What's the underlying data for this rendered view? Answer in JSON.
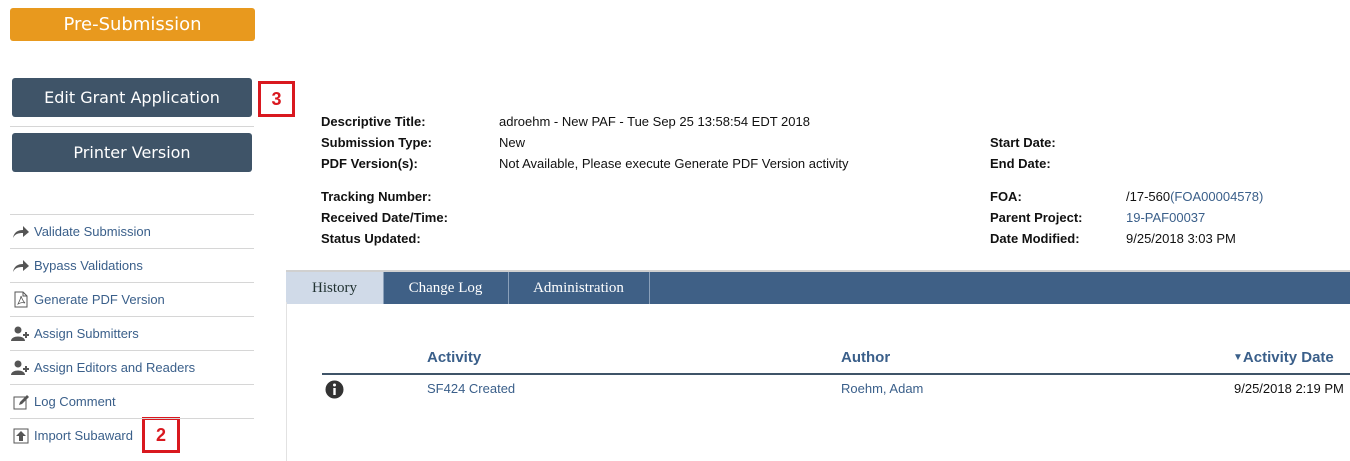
{
  "status": {
    "label": "Pre-Submission",
    "color": "#e8991e"
  },
  "actions": {
    "edit": "Edit Grant Application",
    "print": "Printer Version"
  },
  "callouts": {
    "edit_marker": "3",
    "import_marker": "2"
  },
  "sidebar": {
    "items": [
      {
        "label": "Validate Submission",
        "icon": "share-arrow-icon"
      },
      {
        "label": "Bypass Validations",
        "icon": "share-arrow-icon"
      },
      {
        "label": "Generate PDF Version",
        "icon": "pdf-icon"
      },
      {
        "label": "Assign Submitters",
        "icon": "user-add-icon"
      },
      {
        "label": "Assign Editors and Readers",
        "icon": "user-add-icon"
      },
      {
        "label": "Log Comment",
        "icon": "edit-note-icon"
      },
      {
        "label": "Import Subaward",
        "icon": "upload-icon"
      }
    ]
  },
  "details": {
    "descriptive_title": {
      "label": "Descriptive Title:",
      "value": "adroehm - New PAF - Tue Sep 25 13:58:54 EDT 2018"
    },
    "submission_type": {
      "label": "Submission Type:",
      "value": "New"
    },
    "pdf_versions": {
      "label": "PDF Version(s):",
      "value": "Not Available, Please execute Generate PDF Version activity"
    },
    "tracking_number": {
      "label": "Tracking Number:",
      "value": ""
    },
    "received": {
      "label": "Received Date/Time:",
      "value": ""
    },
    "status_updated": {
      "label": "Status Updated:",
      "value": ""
    },
    "start_date": {
      "label": "Start Date:",
      "value": ""
    },
    "end_date": {
      "label": "End Date:",
      "value": ""
    },
    "foa": {
      "label": "FOA:",
      "prefix": "/17-560",
      "link": "(FOA00004578)"
    },
    "parent_project": {
      "label": "Parent Project:",
      "value": "19-PAF00037"
    },
    "date_modified": {
      "label": "Date Modified:",
      "value": "9/25/2018 3:03 PM"
    }
  },
  "tabs": [
    {
      "label": "History",
      "active": true
    },
    {
      "label": "Change Log",
      "active": false
    },
    {
      "label": "Administration",
      "active": false
    }
  ],
  "history": {
    "columns": {
      "activity": "Activity",
      "author": "Author",
      "date": "Activity Date",
      "sort": "descending"
    },
    "rows": [
      {
        "icon": "info-icon",
        "activity": "SF424 Created",
        "author": "Roehm, Adam",
        "date": "9/25/2018 2:19 PM"
      }
    ]
  },
  "colors": {
    "nav": "#3f5468",
    "tabbar": "#3f6086",
    "link": "#3a5f8a",
    "callout": "#d9181f"
  }
}
